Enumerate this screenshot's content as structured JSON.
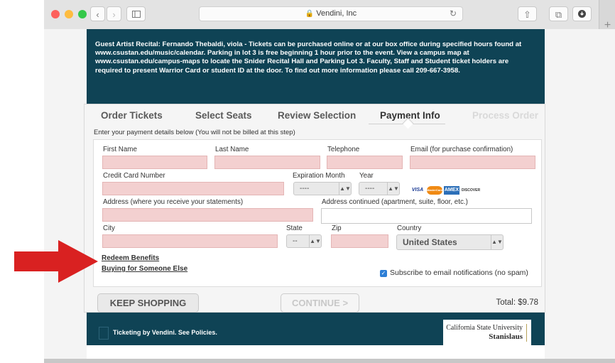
{
  "browser": {
    "url_title": "Vendini, Inc",
    "lock_icon": "lock-icon",
    "new_tab": "+"
  },
  "event_info": "Guest Artist Recital: Fernando Thebaldi, viola - Tickets can be purchased online or at our box office during specified hours found at www.csustan.edu/music/calendar. Parking in lot 3 is free beginning 1 hour prior to the event. View a campus map at www.csustan.edu/campus-maps to locate the Snider Recital Hall and Parking Lot 3. Faculty, Staff and Student ticket holders are required to present Warrior Card or student ID at the door. To find out more information please call 209-667-3958.",
  "steps": [
    {
      "label": "Order Tickets",
      "state": "done"
    },
    {
      "label": "Select Seats",
      "state": "done"
    },
    {
      "label": "Review Selection",
      "state": "done"
    },
    {
      "label": "Payment Info",
      "state": "active"
    },
    {
      "label": "Process Order",
      "state": "future"
    }
  ],
  "instructions": "Enter your payment details below (You will not be billed at this step)",
  "form": {
    "first_name": {
      "label": "First Name",
      "value": ""
    },
    "last_name": {
      "label": "Last Name",
      "value": ""
    },
    "telephone": {
      "label": "Telephone",
      "value": ""
    },
    "email": {
      "label": "Email (for purchase confirmation)",
      "value": ""
    },
    "card_number": {
      "label": "Credit Card Number",
      "value": ""
    },
    "exp_month": {
      "label": "Expiration Month",
      "value": "----"
    },
    "exp_year": {
      "label": "Year",
      "value": "----"
    },
    "card_logos": [
      "VISA",
      "MasterCard",
      "AMEX",
      "DISCOVER"
    ],
    "address": {
      "label": "Address (where you receive your statements)",
      "value": ""
    },
    "address2": {
      "label": "Address continued (apartment, suite, floor, etc.)",
      "value": ""
    },
    "city": {
      "label": "City",
      "value": ""
    },
    "state": {
      "label": "State",
      "value": "--"
    },
    "zip": {
      "label": "Zip",
      "value": ""
    },
    "country": {
      "label": "Country",
      "value": "United States"
    },
    "redeem_link": "Redeem Benefits",
    "gift_link": "Buying for Someone Else",
    "subscribe": {
      "label": "Subscribe to email notifications (no spam)",
      "checked": true
    }
  },
  "buttons": {
    "keep_shopping": "KEEP SHOPPING",
    "continue": "CONTINUE >"
  },
  "total": "Total: $9.78",
  "footer": {
    "text": "Ticketing by Vendini. See Policies.",
    "university_line1": "California State University",
    "university_line2": "Stanislaus"
  },
  "colors": {
    "banner": "#0f4355",
    "required_field": "#f3d0d0",
    "arrow": "#d92121",
    "checkbox": "#2d7fd6"
  }
}
